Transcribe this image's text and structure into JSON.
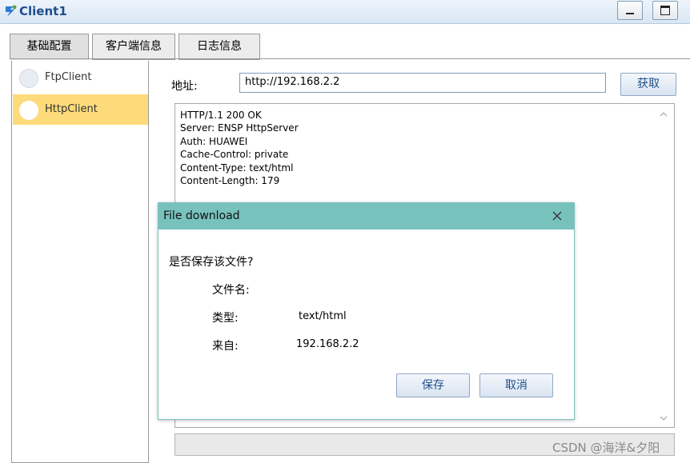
{
  "window": {
    "title": "Client1",
    "icon": "app-client-icon",
    "controls": [
      "minimize-icon",
      "maximize-icon"
    ]
  },
  "tabs": [
    {
      "label": "基础配置",
      "active": true
    },
    {
      "label": "客户端信息",
      "active": false
    },
    {
      "label": "日志信息",
      "active": false
    }
  ],
  "sidebar": {
    "items": [
      {
        "label": "FtpClient",
        "selected": false
      },
      {
        "label": "HttpClient",
        "selected": true
      }
    ]
  },
  "address": {
    "label": "地址:",
    "value": "http://192.168.2.2",
    "fetch_label": "获取"
  },
  "response": {
    "lines": [
      "HTTP/1.1 200 OK",
      "Server: ENSP HttpServer",
      "Auth: HUAWEI",
      "Cache-Control: private",
      "Content-Type: text/html",
      "Content-Length: 179"
    ]
  },
  "dialog": {
    "title": "File download",
    "question": "是否保存该文件?",
    "fields": {
      "filename": {
        "label": "文件名:",
        "value": ""
      },
      "type": {
        "label": "类型:",
        "value": "text/html"
      },
      "from": {
        "label": "来自:",
        "value": "192.168.2.2"
      }
    },
    "save_label": "保存",
    "cancel_label": "取消"
  },
  "watermark": "CSDN @海洋&夕阳",
  "colors": {
    "dialog_header": "#77c2bd",
    "selected_item": "#fddb7a",
    "title_text": "#1f4e8c"
  }
}
